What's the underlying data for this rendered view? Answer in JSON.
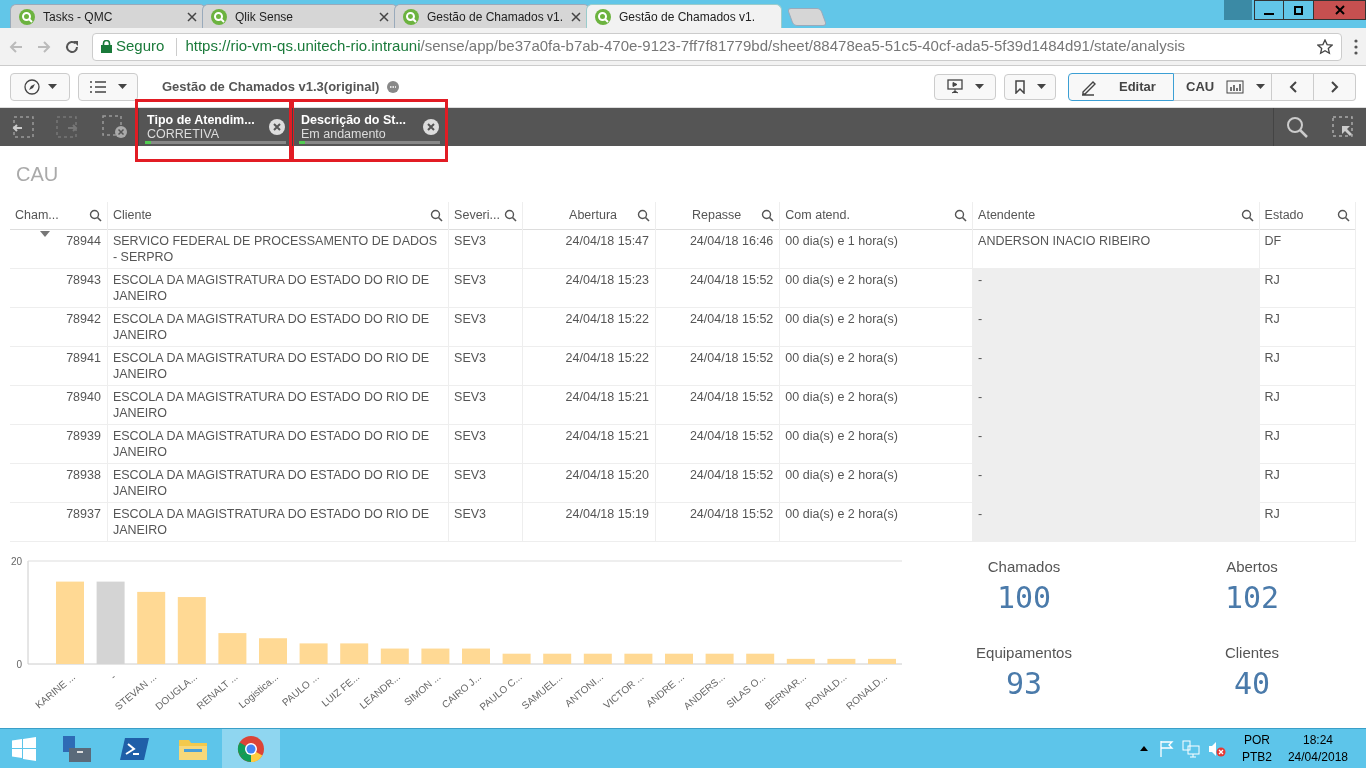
{
  "browser": {
    "tabs": [
      {
        "title": "Tasks - QMC",
        "selected": false
      },
      {
        "title": "Qlik Sense",
        "selected": false
      },
      {
        "title": "Gestão de Chamados v1.",
        "selected": false
      },
      {
        "title": "Gestão de Chamados v1.",
        "selected": true
      }
    ],
    "address": {
      "secure_label": "Seguro",
      "url_host": "https://rio-vm-qs.unitech-rio.intrauni",
      "url_path": "/sense/app/be37a0fa-b7ab-470e-9123-7ff7f81779bd/sheet/88478ea5-51c5-40cf-ada5-5f39d1484d91/state/analysis"
    }
  },
  "toolbar": {
    "app_title": "Gestão de Chamados v1.3(original)",
    "edit_button": "Editar",
    "sheet_name": "CAU"
  },
  "selections": [
    {
      "field": "Tipo de Atendim...",
      "value": "CORRETIVA",
      "highlighted": true
    },
    {
      "field": "Descrição do St...",
      "value": "Em andamento",
      "highlighted": true
    }
  ],
  "sheet_title": "CAU",
  "table": {
    "columns": [
      {
        "label": "Cham..."
      },
      {
        "label": "Cliente"
      },
      {
        "label": "Severi..."
      },
      {
        "label": "Abertura"
      },
      {
        "label": "Repasse"
      },
      {
        "label": "Com atend."
      },
      {
        "label": "Atendente"
      },
      {
        "label": "Estado"
      }
    ],
    "rows": [
      [
        "78944",
        "SERVICO FEDERAL DE PROCESSAMENTO DE DADOS - SERPRO",
        "SEV3",
        "24/04/18 15:47",
        "24/04/18 16:46",
        "00 dia(s) e 1 hora(s)",
        "ANDERSON INACIO RIBEIRO",
        "DF"
      ],
      [
        "78943",
        "ESCOLA DA MAGISTRATURA DO ESTADO DO RIO DE JANEIRO",
        "SEV3",
        "24/04/18 15:23",
        "24/04/18 15:52",
        "00 dia(s) e 2 hora(s)",
        "-",
        "RJ"
      ],
      [
        "78942",
        "ESCOLA DA MAGISTRATURA DO ESTADO DO RIO DE JANEIRO",
        "SEV3",
        "24/04/18 15:22",
        "24/04/18 15:52",
        "00 dia(s) e 2 hora(s)",
        "-",
        "RJ"
      ],
      [
        "78941",
        "ESCOLA DA MAGISTRATURA DO ESTADO DO RIO DE JANEIRO",
        "SEV3",
        "24/04/18 15:22",
        "24/04/18 15:52",
        "00 dia(s) e 2 hora(s)",
        "-",
        "RJ"
      ],
      [
        "78940",
        "ESCOLA DA MAGISTRATURA DO ESTADO DO RIO DE JANEIRO",
        "SEV3",
        "24/04/18 15:21",
        "24/04/18 15:52",
        "00 dia(s) e 2 hora(s)",
        "-",
        "RJ"
      ],
      [
        "78939",
        "ESCOLA DA MAGISTRATURA DO ESTADO DO RIO DE JANEIRO",
        "SEV3",
        "24/04/18 15:21",
        "24/04/18 15:52",
        "00 dia(s) e 2 hora(s)",
        "-",
        "RJ"
      ],
      [
        "78938",
        "ESCOLA DA MAGISTRATURA DO ESTADO DO RIO DE JANEIRO",
        "SEV3",
        "24/04/18 15:20",
        "24/04/18 15:52",
        "00 dia(s) e 2 hora(s)",
        "-",
        "RJ"
      ],
      [
        "78937",
        "ESCOLA DA MAGISTRATURA DO ESTADO DO RIO DE JANEIRO",
        "SEV3",
        "24/04/18 15:19",
        "24/04/18 15:52",
        "00 dia(s) e 2 hora(s)",
        "-",
        "RJ"
      ]
    ]
  },
  "chart": {
    "chart_data": {
      "type": "bar",
      "stacked": true,
      "categories": [
        "KARINE ...",
        "-",
        "STEVAN ...",
        "DOUGLA...",
        "RENALT ...",
        "Logistica...",
        "PAULO ...",
        "LUIZ FE...",
        "LEANDR...",
        "SIMON ...",
        "CAIRO J...",
        "PAULO C...",
        "SAMUEL...",
        "ANTONI...",
        "VICTOR ...",
        "ANDRE ...",
        "ANDERS...",
        "SILAS O...",
        "BERNAR...",
        "RONALD...",
        "RONALD..."
      ],
      "series": [
        {
          "color": "#ffd994",
          "values": [
            16,
            null,
            14,
            13,
            6,
            5,
            4,
            4,
            3,
            3,
            3,
            2,
            2,
            2,
            2,
            2,
            2,
            2,
            1,
            1,
            1
          ]
        },
        {
          "color": "#d4d4d4",
          "values": [
            null,
            16,
            null,
            null,
            null,
            null,
            null,
            null,
            null,
            null,
            null,
            null,
            null,
            null,
            null,
            null,
            null,
            null,
            null,
            null,
            null
          ]
        }
      ],
      "ylim": [
        0,
        20
      ],
      "yticks": [
        0,
        20
      ]
    }
  },
  "kpis": [
    {
      "label": "Chamados",
      "value": "100"
    },
    {
      "label": "Abertos",
      "value": "102"
    },
    {
      "label": "Equipamentos",
      "value": "93"
    },
    {
      "label": "Clientes",
      "value": "40"
    }
  ],
  "taskbar": {
    "language": "POR",
    "layout": "PTB2",
    "time": "18:24",
    "date": "24/04/2018"
  }
}
